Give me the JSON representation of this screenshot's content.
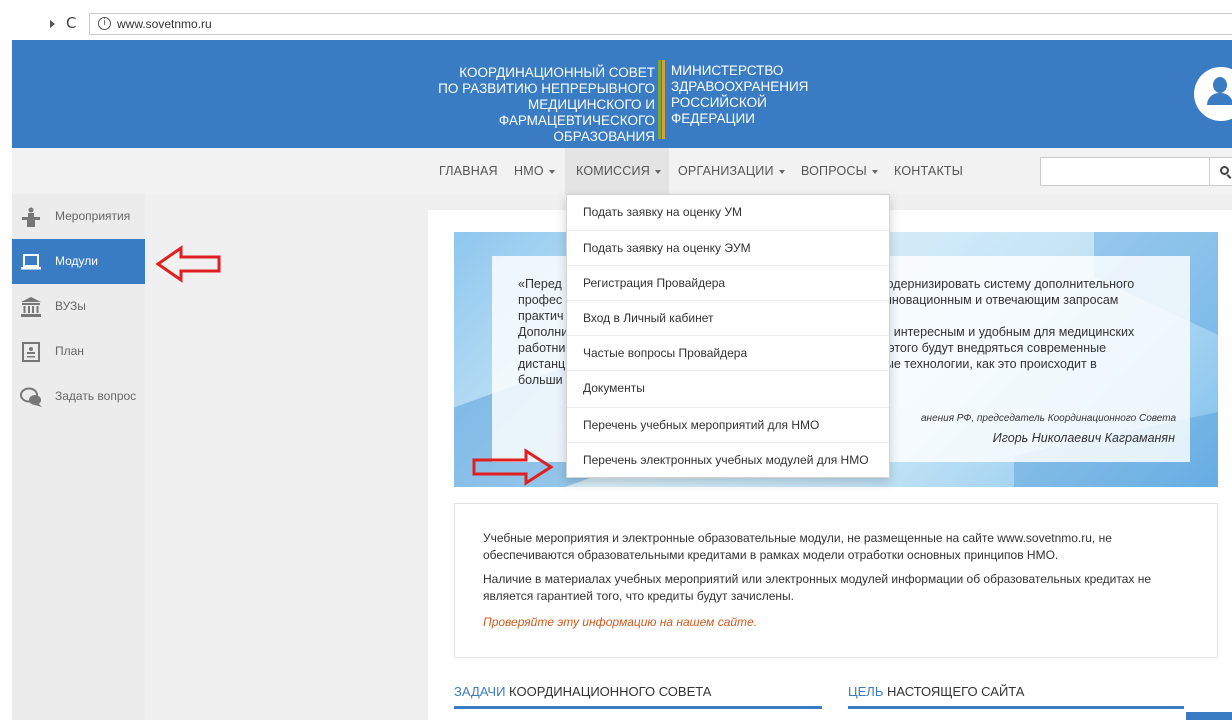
{
  "browser": {
    "url": "www.sovetnmo.ru"
  },
  "header": {
    "coord_lines": [
      "КООРДИНАЦИОННЫЙ СОВЕТ",
      "ПО РАЗВИТИЮ НЕПРЕРЫВНОГО",
      "МЕДИЦИНСКОГО И",
      "ФАРМАЦЕВТИЧЕСКОГО",
      "ОБРАЗОВАНИЯ"
    ],
    "ministry_lines": [
      "МИНИСТЕРСТВО",
      "ЗДРАВООХРАНЕНИЯ",
      "РОССИЙСКОЙ",
      "ФЕДЕРАЦИИ"
    ],
    "colors": {
      "brand_blue": "#3a7cc3",
      "accent_green": "#78a844",
      "accent_orange": "#d8a138"
    }
  },
  "nav": {
    "items": [
      {
        "label": "ГЛАВНАЯ",
        "caret": false
      },
      {
        "label": "НМО",
        "caret": true
      },
      {
        "label": "КОМИССИЯ",
        "caret": true,
        "active": true
      },
      {
        "label": "ОРГАНИЗАЦИИ",
        "caret": true
      },
      {
        "label": "ВОПРОСЫ",
        "caret": true
      },
      {
        "label": "КОНТАКТЫ",
        "caret": false
      }
    ],
    "search_placeholder": ""
  },
  "sidebar": {
    "items": [
      {
        "label": "Мероприятия",
        "icon": "podium-icon"
      },
      {
        "label": "Модули",
        "icon": "laptop-icon",
        "active": true
      },
      {
        "label": "ВУЗы",
        "icon": "university-icon"
      },
      {
        "label": "План",
        "icon": "document-icon"
      },
      {
        "label": "Задать вопрос",
        "icon": "chat-bubbles-icon"
      }
    ]
  },
  "dropdown": {
    "items": [
      "Подать заявку на оценку УМ",
      "Подать заявку на оценку ЭУМ",
      "Регистрация Провайдера",
      "Вход в Личный кабинет",
      "Частые вопросы Провайдера",
      "Документы",
      "Перечень учебных мероприятий для НМО",
      "Перечень электронных учебных модулей для НМО"
    ]
  },
  "quote": {
    "left_lines": [
      "«Перед",
      "профес",
      "практич",
      "Дополни",
      "работни",
      "дистанц",
      "больши"
    ],
    "right_lines": [
      "модернизировать систему дополнительного",
      "инновационным и отвечающим запросам",
      "",
      "ть интересным и удобным для медицинских",
      "я этого будут внедряться современные",
      "ные технологии, как это происходит в"
    ],
    "attribution": "анения РФ, председатель Координационного Совета",
    "author": "Игорь Николаевич Каграманян"
  },
  "notice": {
    "p1": "Учебные мероприятия и электронные образовательные модули, не размещенные на сайте www.sovetnmo.ru, не обеспечиваются образовательными кредитами в рамках модели отработки основных принципов НМО.",
    "p2": "Наличие в материалах учебных мероприятий или электронных модулей информации об образовательных кредитах не является гарантией того, что кредиты будут зачислены.",
    "p3": "Проверяйте эту информацию на нашем сайте."
  },
  "sections": {
    "tasks": {
      "highlight": "ЗАДАЧИ",
      "rest": " КООРДИНАЦИОННОГО СОВЕТА"
    },
    "goal": {
      "highlight": "ЦЕЛЬ",
      "rest": " НАСТОЯЩЕГО САЙТА"
    }
  },
  "annotations": {
    "arrow_color": "#e02020"
  }
}
